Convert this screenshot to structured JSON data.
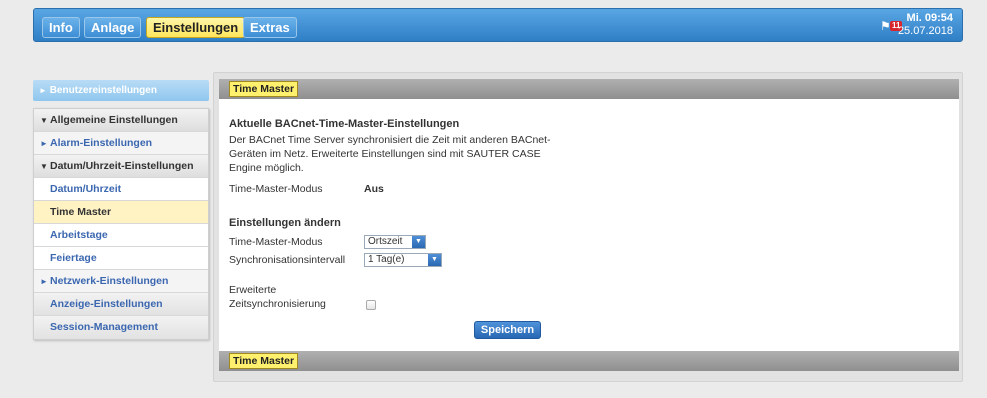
{
  "nav": {
    "tabs": [
      "Info",
      "Anlage",
      "Einstellungen",
      "Extras"
    ],
    "active_tab": "Einstellungen",
    "alarm_count": "11",
    "clock_time": "Mi. 09:54",
    "clock_date": "25.07.2018"
  },
  "sidebar": {
    "top_item": "Benutzereinstellungen",
    "items": [
      {
        "label": "Allgemeine Einstellungen",
        "kind": "group",
        "arrow": "▼"
      },
      {
        "label": "Alarm-Einstellungen",
        "kind": "link",
        "arrow": "►"
      },
      {
        "label": "Datum/Uhrzeit-Einstellungen",
        "kind": "group",
        "arrow": "▼"
      },
      {
        "label": "Datum/Uhrzeit",
        "kind": "sub",
        "arrow": ""
      },
      {
        "label": "Time Master",
        "kind": "sub-active",
        "arrow": ""
      },
      {
        "label": "Arbeitstage",
        "kind": "sub",
        "arrow": ""
      },
      {
        "label": "Feiertage",
        "kind": "sub",
        "arrow": ""
      },
      {
        "label": "Netzwerk-Einstellungen",
        "kind": "link",
        "arrow": "►"
      },
      {
        "label": "Anzeige-Einstellungen",
        "kind": "plain",
        "arrow": ""
      },
      {
        "label": "Session-Management",
        "kind": "plain",
        "arrow": ""
      }
    ]
  },
  "panel": {
    "header_label": "Time Master",
    "footer_label": "Time Master",
    "section_title": "Aktuelle BACnet-Time-Master-Einstellungen",
    "description_lines": [
      "Der BACnet Time Server synchronisiert die Zeit mit anderen BACnet-",
      "Geräten im Netz. Erweiterte Einstellungen sind mit SAUTER CASE",
      "Engine möglich."
    ],
    "current_mode_label": "Time-Master-Modus",
    "current_mode_value": "Aus",
    "change_title": "Einstellungen ändern",
    "mode_label": "Time-Master-Modus",
    "mode_value": "Ortszeit",
    "interval_label": "Synchronisationsintervall",
    "interval_value": "1 Tag(e)",
    "extended_label_line1": "Erweiterte",
    "extended_label_line2": "Zeitsynchronisierung",
    "extended_checked": false,
    "save_label": "Speichern"
  },
  "colors": {
    "topbar": "#3d8ed5",
    "active_tab": "#ffe55c",
    "link": "#3b67b0",
    "save_button": "#2f74c2"
  }
}
